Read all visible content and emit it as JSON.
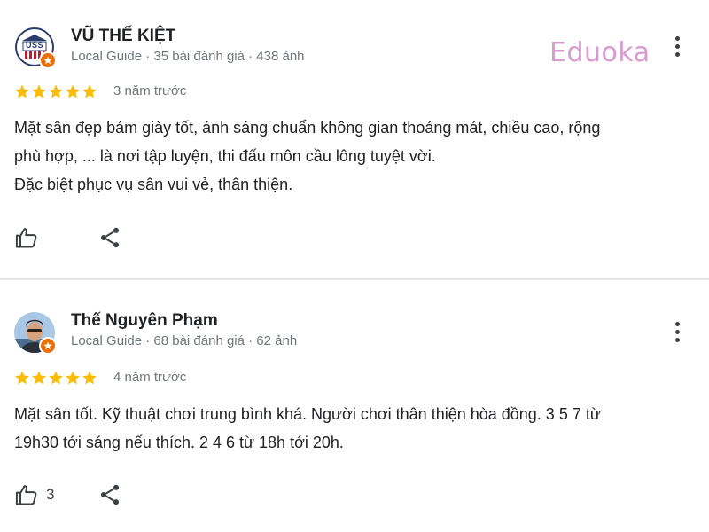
{
  "watermark": "Eduoka",
  "reviews": [
    {
      "author": "VŨ THẾ KIỆT",
      "meta": "Local Guide · 35 bài đánh giá · 438 ảnh",
      "avatar_text": "USS",
      "rating": 5,
      "time": "3 năm trước",
      "body": [
        "Mặt sân đẹp bám giày tốt, ánh sáng chuẩn không gian thoáng mát, chiều cao, rộng",
        "phù hợp, ... là nơi tập luyện, thi đấu môn cầu lông tuyệt vời.",
        "Đặc biệt phục vụ sân vui vẻ, thân thiện."
      ],
      "like_count": ""
    },
    {
      "author": "Thế Nguyên Phạm",
      "meta": "Local Guide · 68 bài đánh giá · 62 ảnh",
      "rating": 5,
      "time": "4 năm trước",
      "body": [
        "Mặt sân tốt. Kỹ thuật chơi trung bình khá. Người chơi thân thiện hòa đồng. 3 5 7 từ",
        "19h30 tới sáng nếu thích. 2 4 6 từ 18h tới 20h."
      ],
      "like_count": "3"
    }
  ],
  "icons": {
    "star_color": "#fbbc04",
    "badge_color": "#e8710a",
    "icon_color": "#3c4043"
  }
}
